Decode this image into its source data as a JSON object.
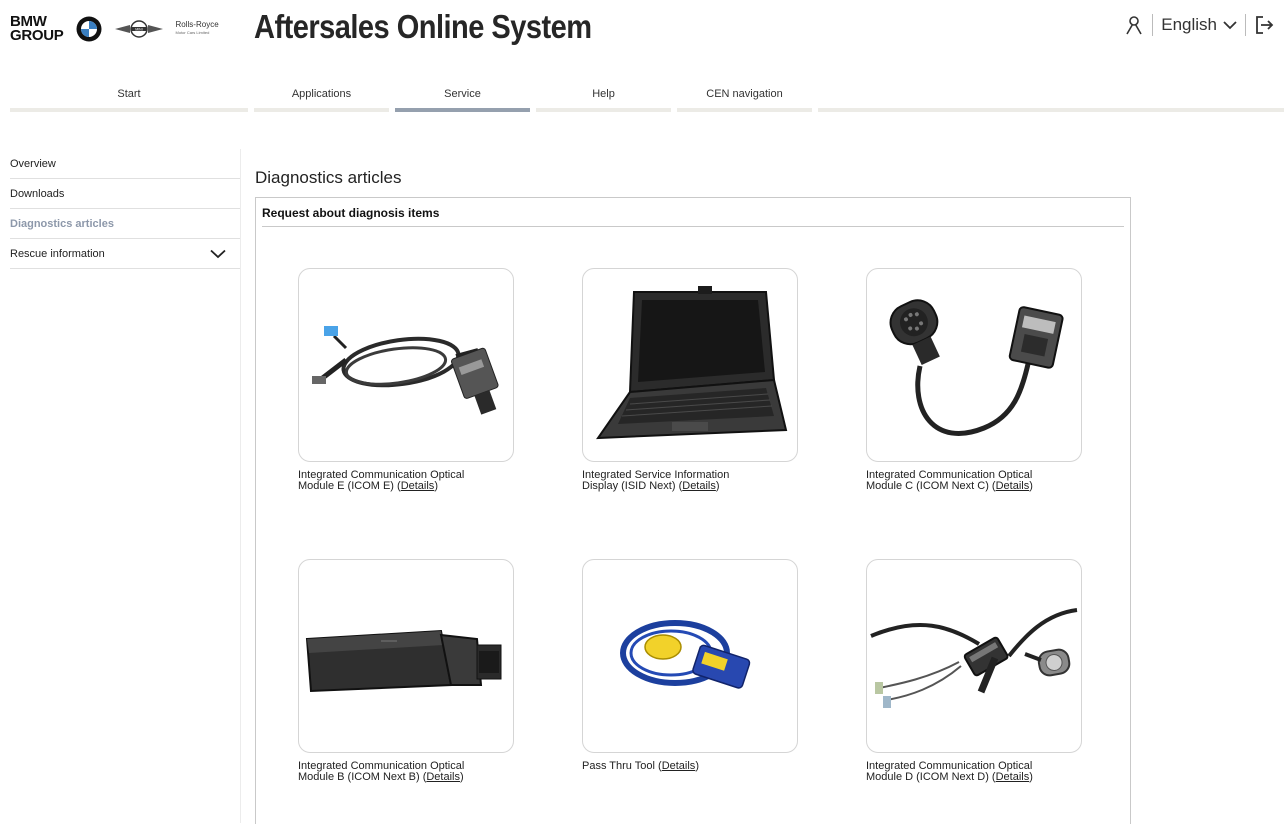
{
  "header": {
    "group_logo": "BMW GROUP",
    "rr_logo": "Rolls-Royce",
    "rr_sub": "Motor Cars Limited",
    "mini_logo": "MINI",
    "app_title": "Aftersales Online System",
    "language": "English",
    "icons": [
      "user-icon",
      "chevron-down-icon",
      "logout-icon"
    ]
  },
  "nav": {
    "tabs": [
      {
        "label": "Start",
        "active": false
      },
      {
        "label": "Applications",
        "active": false
      },
      {
        "label": "Service",
        "active": true
      },
      {
        "label": "Help",
        "active": false
      },
      {
        "label": "CEN navigation",
        "active": false
      }
    ]
  },
  "sidebar": {
    "items": [
      {
        "label": "Overview"
      },
      {
        "label": "Downloads"
      },
      {
        "label": "Diagnostics articles",
        "active": true
      },
      {
        "label": "Rescue information",
        "expandable": true
      }
    ]
  },
  "content": {
    "title": "Diagnostics articles",
    "panel_title": "Request about diagnosis items",
    "details_label": "Details",
    "cards": [
      {
        "line1": "Integrated Communication Optical",
        "line2_prefix": "Module E (ICOM E) (",
        "line2_suffix": ")",
        "image": "icom-e-cable"
      },
      {
        "line1": "Integrated Service Information",
        "line2_prefix": "Display (ISID Next) (",
        "line2_suffix": ")",
        "image": "laptop"
      },
      {
        "line1": "Integrated Communication Optical",
        "line2_prefix": "Module C (ICOM Next C) (",
        "line2_suffix": ")",
        "image": "icom-c-cable"
      },
      {
        "line1": "Integrated Communication Optical",
        "line2_prefix": "Module B (ICOM Next B) (",
        "line2_suffix": ")",
        "image": "icom-b-module"
      },
      {
        "line1": "",
        "line2_prefix": "Pass Thru Tool (",
        "line2_suffix": ")",
        "image": "pass-thru-tool"
      },
      {
        "line1": "Integrated Communication Optical",
        "line2_prefix": "Module D (ICOM Next D) (",
        "line2_suffix": ")",
        "image": "icom-d-cables"
      }
    ]
  }
}
